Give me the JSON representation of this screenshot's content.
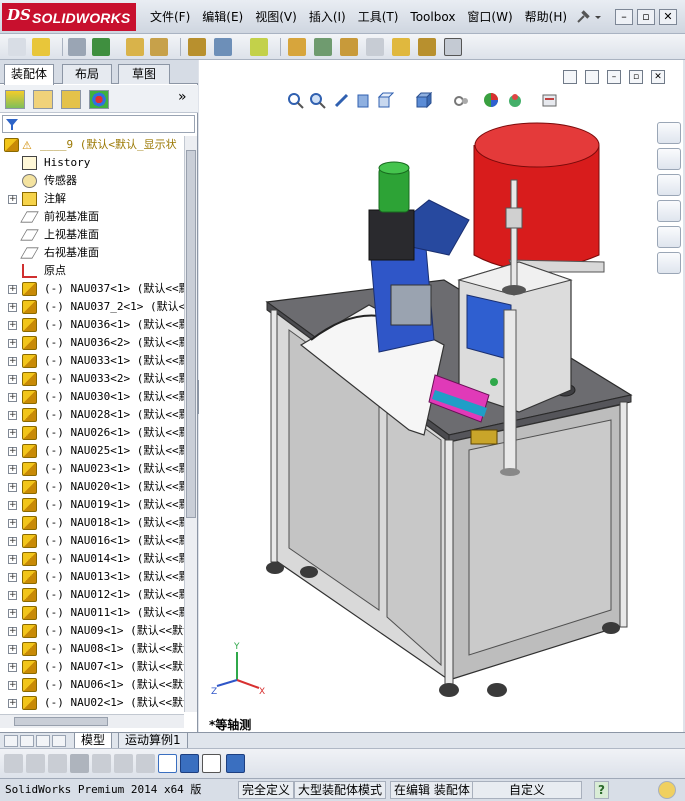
{
  "app": {
    "logo_ds": "DS",
    "logo_name": "SOLIDWORKS",
    "menu": [
      "文件(F)",
      "编辑(E)",
      "视图(V)",
      "插入(I)",
      "工具(T)",
      "Toolbox",
      "窗口(W)",
      "帮助(H)"
    ]
  },
  "panel": {
    "tabs": [
      "装配体",
      "布局",
      "草图"
    ],
    "filter_icon": "funnel-icon",
    "expand_more": "»"
  },
  "tree": {
    "root_label": "____9  (默认<默认_显示状",
    "items": [
      {
        "type": "history",
        "label": "History",
        "expandable": false
      },
      {
        "type": "sensor",
        "label": "传感器",
        "expandable": false
      },
      {
        "type": "annotation",
        "label": "注解",
        "expandable": true
      },
      {
        "type": "plane",
        "label": "前视基准面",
        "expandable": false
      },
      {
        "type": "plane",
        "label": "上视基准面",
        "expandable": false
      },
      {
        "type": "plane",
        "label": "右视基准面",
        "expandable": false
      },
      {
        "type": "origin",
        "label": "原点",
        "expandable": false
      },
      {
        "type": "asm",
        "label": "(-) NAU037<1> (默认<<默",
        "expandable": true
      },
      {
        "type": "asm",
        "label": "(-) NAU037_2<1> (默认<<",
        "expandable": true
      },
      {
        "type": "asm",
        "label": "(-) NAU036<1> (默认<<默",
        "expandable": true
      },
      {
        "type": "asm",
        "label": "(-) NAU036<2> (默认<<默",
        "expandable": true
      },
      {
        "type": "asm",
        "label": "(-) NAU033<1> (默认<<默",
        "expandable": true
      },
      {
        "type": "asm",
        "label": "(-) NAU033<2> (默认<<默",
        "expandable": true
      },
      {
        "type": "asm",
        "label": "(-) NAU030<1> (默认<<默",
        "expandable": true
      },
      {
        "type": "asm",
        "label": "(-) NAU028<1> (默认<<默",
        "expandable": true
      },
      {
        "type": "asm",
        "label": "(-) NAU026<1> (默认<<默",
        "expandable": true
      },
      {
        "type": "asm",
        "label": "(-) NAU025<1> (默认<<默",
        "expandable": true
      },
      {
        "type": "asm",
        "label": "(-) NAU023<1> (默认<<默",
        "expandable": true
      },
      {
        "type": "asm",
        "label": "(-) NAU020<1> (默认<<默",
        "expandable": true
      },
      {
        "type": "asm",
        "label": "(-) NAU019<1> (默认<<默",
        "expandable": true
      },
      {
        "type": "asm",
        "label": "(-) NAU018<1> (默认<<默",
        "expandable": true
      },
      {
        "type": "asm",
        "label": "(-) NAU016<1> (默认<<默",
        "expandable": true
      },
      {
        "type": "asm",
        "label": "(-) NAU014<1> (默认<<默",
        "expandable": true
      },
      {
        "type": "asm",
        "label": "(-) NAU013<1> (默认<<默",
        "expandable": true
      },
      {
        "type": "asm",
        "label": "(-) NAU012<1> (默认<<默",
        "expandable": true
      },
      {
        "type": "asm",
        "label": "(-) NAU011<1> (默认<<默",
        "expandable": true
      },
      {
        "type": "asm",
        "label": "(-) NAU09<1> (默认<<默认",
        "expandable": true
      },
      {
        "type": "asm",
        "label": "(-) NAU08<1> (默认<<默认",
        "expandable": true
      },
      {
        "type": "asm",
        "label": "(-) NAU07<1> (默认<<默认",
        "expandable": true
      },
      {
        "type": "asm",
        "label": "(-) NAU06<1> (默认<<默认",
        "expandable": true
      },
      {
        "type": "asm",
        "label": "(-) NAU02<1> (默认<<默认",
        "expandable": true
      }
    ]
  },
  "graphics": {
    "view_name": "*等轴测",
    "triad": {
      "x": "X",
      "y": "Y",
      "z": "Z"
    }
  },
  "bottom_tabs": [
    "模型",
    "运动算例1"
  ],
  "status": {
    "product": "SolidWorks Premium 2014 x64 版",
    "fully_defined": "完全定义",
    "large_assembly": "大型装配体模式",
    "editing": "在编辑 装配体",
    "custom": "自定义",
    "help_icon": "?"
  },
  "colors": {
    "brand": "#c8102e",
    "accent_blue": "#2f56c8",
    "part_yellow": "#f3cc2a"
  }
}
